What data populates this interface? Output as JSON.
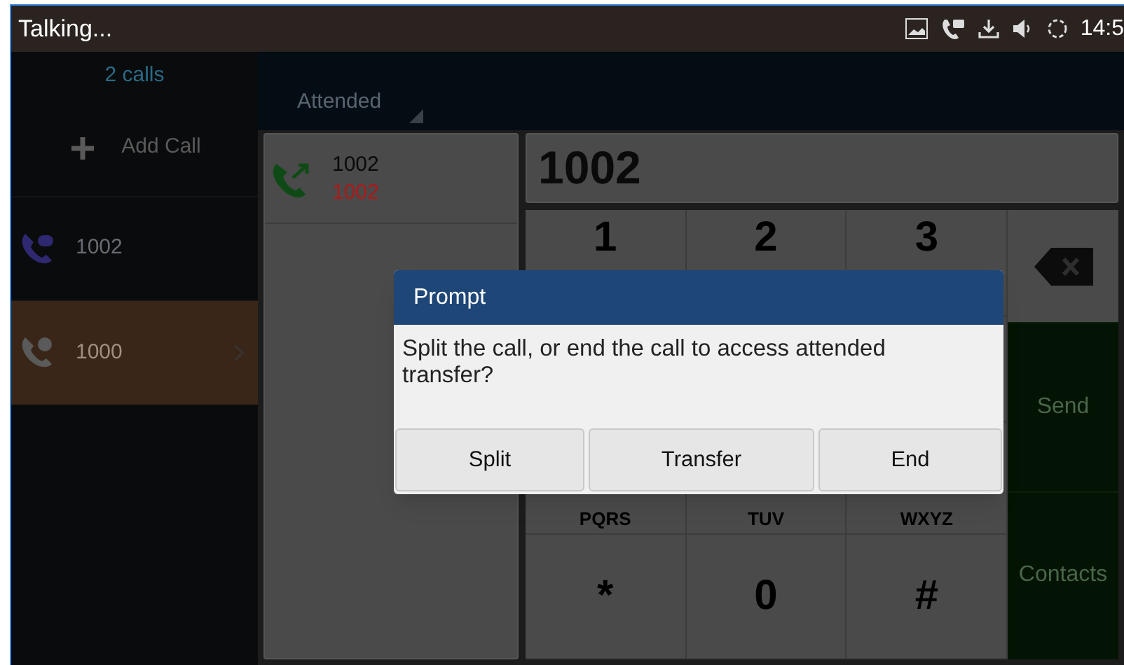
{
  "status_bar": {
    "title": "Talking...",
    "time": "14:5"
  },
  "sidebar": {
    "header": "2 calls",
    "add_call": "Add Call",
    "calls": [
      {
        "number": "1002",
        "kind": "held",
        "selected": false
      },
      {
        "number": "1000",
        "kind": "active",
        "selected": true
      }
    ]
  },
  "transfer_mode": "Attended",
  "call_list": [
    {
      "name": "1002",
      "number": "1002"
    }
  ],
  "dial_display": "1002",
  "keypad": [
    [
      {
        "digit": "1"
      },
      {
        "digit": "2"
      },
      {
        "digit": "3"
      }
    ],
    [
      {
        "letters": "PQRS"
      },
      {
        "letters": "TUV"
      },
      {
        "letters": "WXYZ"
      }
    ],
    [
      {
        "digit": "*"
      },
      {
        "digit": "0"
      },
      {
        "digit": "#"
      }
    ]
  ],
  "side_buttons": [
    "Send",
    "Contacts"
  ],
  "dialog": {
    "title": "Prompt",
    "message": "Split the call, or end the call to access attended transfer?",
    "buttons": [
      "Split",
      "Transfer",
      "End"
    ]
  }
}
